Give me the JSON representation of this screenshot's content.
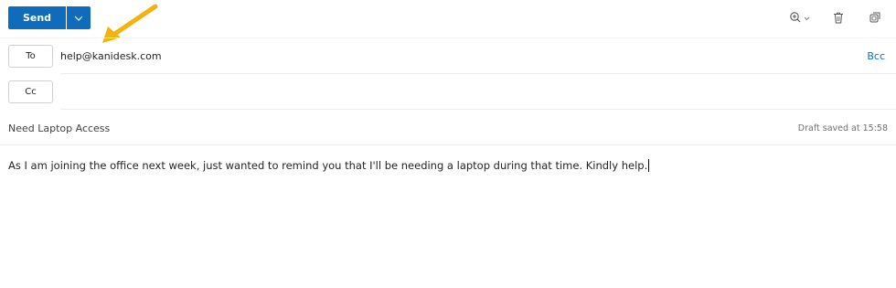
{
  "toolbar": {
    "send_label": "Send",
    "icons": [
      "zoom-icon",
      "chevron-down-icon",
      "trash-icon",
      "popout-icon"
    ]
  },
  "recipients": {
    "to_label": "To",
    "to_value": "help@kanidesk.com",
    "cc_label": "Cc",
    "bcc_label": "Bcc"
  },
  "subject": "Need Laptop Access",
  "status": "Draft saved at 15:58",
  "body": "As I am joining the office next week, just wanted to remind you that I'll be needing a laptop during that time. Kindly help.",
  "colors": {
    "accent": "#0f6cbd",
    "annotation_arrow": "#f2b30f"
  }
}
